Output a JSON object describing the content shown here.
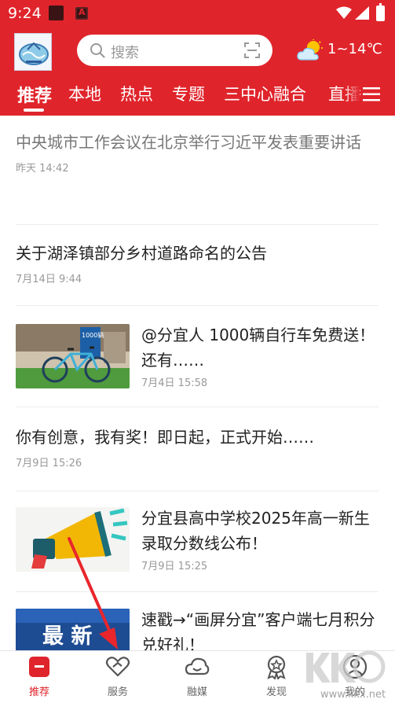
{
  "status_bar": {
    "time": "9:24"
  },
  "search": {
    "placeholder": "搜索"
  },
  "weather": {
    "temp": "1~14℃",
    "icon": "partly-cloudy-icon"
  },
  "tabs": [
    {
      "label": "推荐",
      "active": true
    },
    {
      "label": "本地"
    },
    {
      "label": "热点"
    },
    {
      "label": "专题"
    },
    {
      "label": "三中心融合"
    },
    {
      "label": "直播"
    }
  ],
  "feed": [
    {
      "title": "中央城市工作会议在北京举行习近平发表重要讲话",
      "time": "昨天 14:42",
      "read": true
    },
    {
      "title": "关于湖泽镇部分乡村道路命名的公告",
      "time": "7月14日 9:44"
    },
    {
      "title": "@分宜人 1000辆自行车免费送！还有……",
      "time": "7月4日 15:58",
      "thumb_badge": "1000辆"
    },
    {
      "title": "你有创意，我有奖！即日起，正式开始……",
      "time": "7月9日 15:26"
    },
    {
      "title": "分宜县高中学校2025年高一新生录取分数线公布！",
      "time": "7月9日 15:25"
    },
    {
      "title": "速戳→“画屏分宜”客户端七月积分兑好礼！",
      "thumb_text": "最 新"
    }
  ],
  "bottom_nav": [
    {
      "label": "推荐",
      "icon": "home-recommend-icon",
      "active": true
    },
    {
      "label": "服务",
      "icon": "handshake-heart-icon"
    },
    {
      "label": "融媒",
      "icon": "cloud-smile-icon"
    },
    {
      "label": "发现",
      "icon": "badge-award-icon"
    },
    {
      "label": "我的",
      "icon": "user-circle-icon"
    }
  ],
  "watermark": {
    "text": "www.kkx.net"
  },
  "colors": {
    "brand_red": "#e0242b",
    "text": "#222222",
    "muted": "#999999"
  }
}
